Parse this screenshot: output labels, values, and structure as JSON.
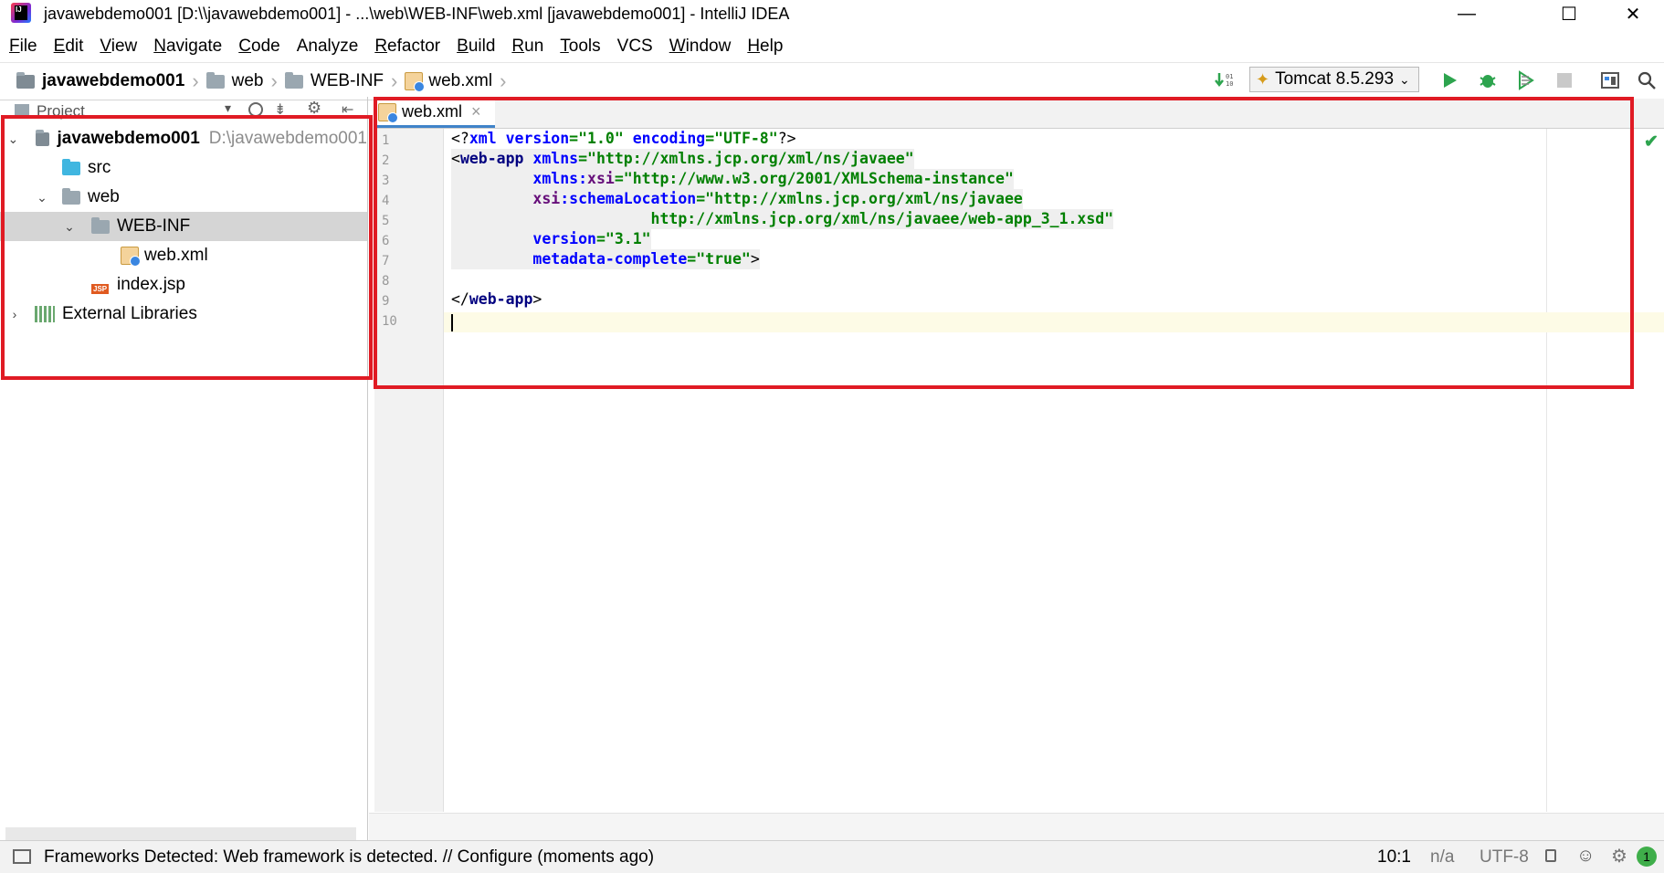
{
  "window": {
    "title": "javawebdemo001 [D:\\\\javawebdemo001] - ...\\web\\WEB-INF\\web.xml [javawebdemo001] - IntelliJ IDEA",
    "icon_label": "IJ",
    "minimize_glyph": "—",
    "maximize_glyph": "☐",
    "close_glyph": "✕"
  },
  "menu": [
    {
      "mnemonic": "F",
      "rest": "ile"
    },
    {
      "mnemonic": "E",
      "rest": "dit"
    },
    {
      "mnemonic": "V",
      "rest": "iew"
    },
    {
      "mnemonic": "N",
      "rest": "avigate"
    },
    {
      "mnemonic": "C",
      "rest": "ode"
    },
    {
      "mnemonic": "",
      "rest": "Analyze"
    },
    {
      "mnemonic": "R",
      "rest": "efactor"
    },
    {
      "mnemonic": "B",
      "rest": "uild"
    },
    {
      "mnemonic": "R",
      "rest": "un"
    },
    {
      "mnemonic": "T",
      "rest": "ools"
    },
    {
      "mnemonic": "",
      "rest": "VCS"
    },
    {
      "mnemonic": "W",
      "rest": "indow"
    },
    {
      "mnemonic": "H",
      "rest": "elp"
    }
  ],
  "breadcrumb": [
    "javawebdemo001",
    "web",
    "WEB-INF",
    "web.xml"
  ],
  "toolbar": {
    "run_config": "Tomcat 8.5.293",
    "icons": [
      "vcs-update-icon",
      "run-icon",
      "debug-icon",
      "coverage-icon",
      "stop-icon",
      "project-structure-icon",
      "search-icon"
    ]
  },
  "project_panel": {
    "title": "Project",
    "tree": [
      {
        "label": "javawebdemo001",
        "path": "D:\\javawebdemo001",
        "arrow": "⌄",
        "icon": "module-folder-icon"
      },
      {
        "label": "src",
        "arrow": "",
        "icon": "source-folder-icon"
      },
      {
        "label": "web",
        "arrow": "⌄",
        "icon": "folder-icon"
      },
      {
        "label": "WEB-INF",
        "arrow": "⌄",
        "icon": "folder-icon"
      },
      {
        "label": "web.xml",
        "arrow": "",
        "icon": "xml-file-icon"
      },
      {
        "label": "index.jsp",
        "arrow": "",
        "icon": "jsp-file-icon"
      },
      {
        "label": "External Libraries",
        "arrow": "›",
        "icon": "library-icon"
      }
    ]
  },
  "editor": {
    "tab_label": "web.xml",
    "tab_close": "×",
    "line_numbers": [
      "1",
      "2",
      "3",
      "4",
      "5",
      "6",
      "7",
      "8",
      "9",
      "10"
    ],
    "code_lines": [
      "<?xml version=\"1.0\" encoding=\"UTF-8\"?>",
      "<web-app xmlns=\"http://xmlns.jcp.org/xml/ns/javaee\"",
      "         xmlns:xsi=\"http://www.w3.org/2001/XMLSchema-instance\"",
      "         xsi:schemaLocation=\"http://xmlns.jcp.org/xml/ns/javaee",
      "                      http://xmlns.jcp.org/xml/ns/javaee/web-app_3_1.xsd\"",
      "         version=\"3.1\"",
      "         metadata-complete=\"true\">",
      "",
      "</web-app>",
      ""
    ],
    "check_glyph": "✔"
  },
  "statusbar": {
    "message": "Frameworks Detected: Web framework is detected. // Configure (moments ago)",
    "position": "10:1",
    "line_sep": "n/a",
    "encoding": "UTF-8",
    "notifications": "1"
  },
  "colors": {
    "highlight_box": "#e01b24",
    "xml_tag": "#000080",
    "xml_attr": "#0000ff",
    "xml_value": "#008000",
    "run_green": "#2da44e"
  }
}
